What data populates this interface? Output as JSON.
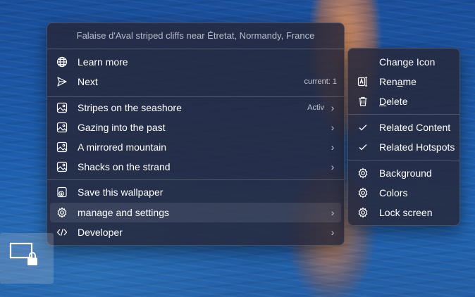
{
  "main_menu": {
    "header": "Falaise d'Aval striped cliffs near Étretat, Normandy, France",
    "items": [
      {
        "label": "Learn more",
        "icon": "globe-icon"
      },
      {
        "label": "Next",
        "icon": "send-icon",
        "right": "current: 1"
      },
      {
        "label": "Stripes on the seashore",
        "icon": "image-icon",
        "right": "Activ",
        "chevron": true
      },
      {
        "label": "Gazing into the past",
        "icon": "image-icon",
        "chevron": true
      },
      {
        "label": "A mirrored mountain",
        "icon": "image-icon",
        "chevron": true
      },
      {
        "label": "Shacks on the strand",
        "icon": "image-icon",
        "chevron": true
      },
      {
        "label": "Save this wallpaper",
        "icon": "save-image-icon"
      },
      {
        "label": "manage and settings",
        "icon": "gear-icon",
        "chevron": true,
        "highlighted": true
      },
      {
        "label": "Developer",
        "icon": "code-icon",
        "chevron": true
      }
    ]
  },
  "sub_menu": {
    "items": [
      {
        "label": "Change Icon"
      },
      {
        "label_pre": "Ren",
        "label_ul": "a",
        "label_post": "me",
        "icon": "rename-icon"
      },
      {
        "label_pre": "",
        "label_ul": "D",
        "label_post": "elete",
        "icon": "trash-icon"
      },
      {
        "label": "Related Content",
        "icon": "check-icon"
      },
      {
        "label": "Related Hotspots",
        "icon": "check-icon"
      },
      {
        "label": "Background",
        "icon": "gear-icon"
      },
      {
        "label": "Colors",
        "icon": "gear-icon"
      },
      {
        "label": "Lock screen",
        "icon": "gear-icon"
      }
    ]
  },
  "chevron_glyph": "›",
  "tray_icon": "screen-lock-icon"
}
